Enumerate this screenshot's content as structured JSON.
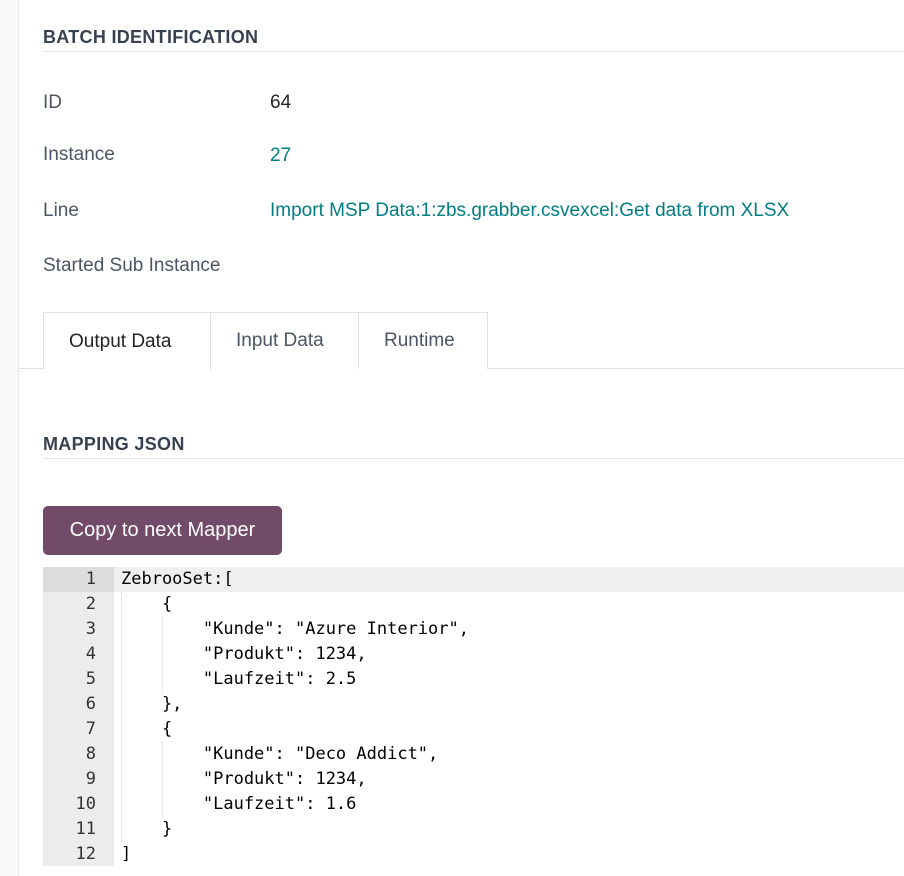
{
  "batch_section": {
    "title": "BATCH IDENTIFICATION"
  },
  "fields": {
    "id": {
      "label": "ID",
      "value": "64"
    },
    "instance": {
      "label": "Instance",
      "value": "27"
    },
    "line": {
      "label": "Line",
      "value": "Import MSP Data:1:zbs.grabber.csvexcel:Get data from XLSX"
    },
    "started_sub_instance": {
      "label": "Started Sub Instance",
      "value": ""
    }
  },
  "tabs": [
    {
      "label": "Output Data",
      "active": true
    },
    {
      "label": "Input Data",
      "active": false
    },
    {
      "label": "Runtime",
      "active": false
    }
  ],
  "mapping_section": {
    "title": "MAPPING JSON"
  },
  "copy_button": {
    "label": "Copy to next Mapper"
  },
  "editor": {
    "active_line": 1,
    "lines": [
      {
        "n": "1",
        "text": "ZebrooSet:["
      },
      {
        "n": "2",
        "text": "    {"
      },
      {
        "n": "3",
        "text": "        \"Kunde\": \"Azure Interior\","
      },
      {
        "n": "4",
        "text": "        \"Produkt\": 1234,"
      },
      {
        "n": "5",
        "text": "        \"Laufzeit\": 2.5"
      },
      {
        "n": "6",
        "text": "    },"
      },
      {
        "n": "7",
        "text": "    {"
      },
      {
        "n": "8",
        "text": "        \"Kunde\": \"Deco Addict\","
      },
      {
        "n": "9",
        "text": "        \"Produkt\": 1234,"
      },
      {
        "n": "10",
        "text": "        \"Laufzeit\": 1.6"
      },
      {
        "n": "11",
        "text": "    }"
      },
      {
        "n": "12",
        "text": "]"
      }
    ]
  },
  "colors": {
    "accent": "#714b67",
    "link": "#017e84"
  }
}
